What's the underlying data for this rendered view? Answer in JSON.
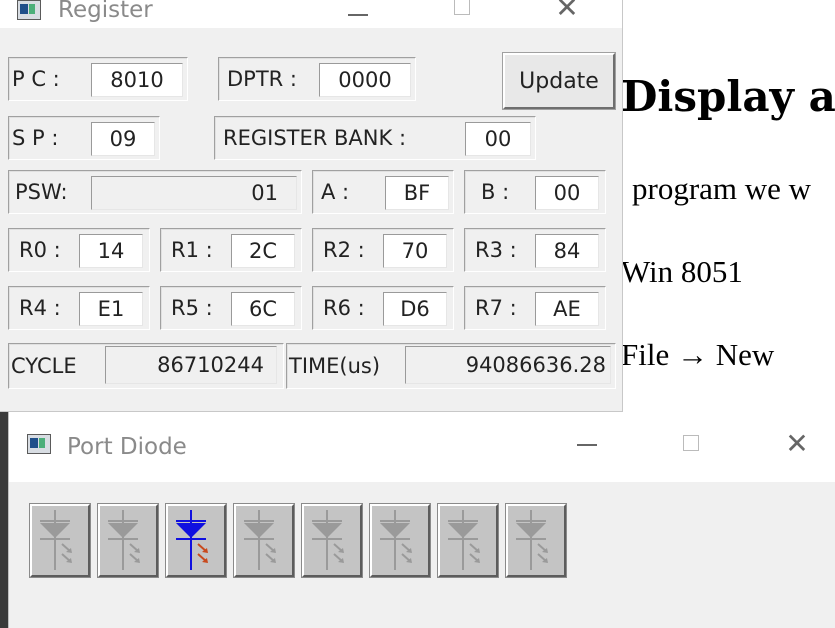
{
  "document": {
    "heading": "Display a",
    "lines": [
      "program we w",
      "Win 8051",
      "File → New"
    ]
  },
  "register_window": {
    "title": "Register",
    "update_label": "Update",
    "pc": {
      "label": "P C  :",
      "value": "8010"
    },
    "dptr": {
      "label": "DPTR :",
      "value": "0000"
    },
    "sp": {
      "label": "S P  :",
      "value": "09"
    },
    "bank": {
      "label": "REGISTER BANK :",
      "value": "00"
    },
    "psw": {
      "label": "PSW:",
      "value": "01"
    },
    "a": {
      "label": "A   :",
      "value": "BF"
    },
    "b": {
      "label": "B  :",
      "value": "00"
    },
    "r0": {
      "label": "R0 :",
      "value": "14"
    },
    "r1": {
      "label": "R1 :",
      "value": "2C"
    },
    "r2": {
      "label": "R2 :",
      "value": "70"
    },
    "r3": {
      "label": "R3 :",
      "value": "84"
    },
    "r4": {
      "label": "R4 :",
      "value": "E1"
    },
    "r5": {
      "label": "R5 :",
      "value": "6C"
    },
    "r6": {
      "label": "R6 :",
      "value": "D6"
    },
    "r7": {
      "label": "R7 :",
      "value": "AE"
    },
    "cycle": {
      "label": "CYCLE",
      "value": "86710244"
    },
    "time": {
      "label": "TIME(us)",
      "value": "94086636.28"
    }
  },
  "port_window": {
    "title": "Port Diode",
    "diodes": [
      {
        "on": false
      },
      {
        "on": false
      },
      {
        "on": true
      },
      {
        "on": false
      },
      {
        "on": false
      },
      {
        "on": false
      },
      {
        "on": false
      },
      {
        "on": false
      }
    ],
    "colors": {
      "diode_on": "#1010e0",
      "arrow_on": "#c84a1e",
      "diode_off": "#9a9a9a"
    }
  }
}
